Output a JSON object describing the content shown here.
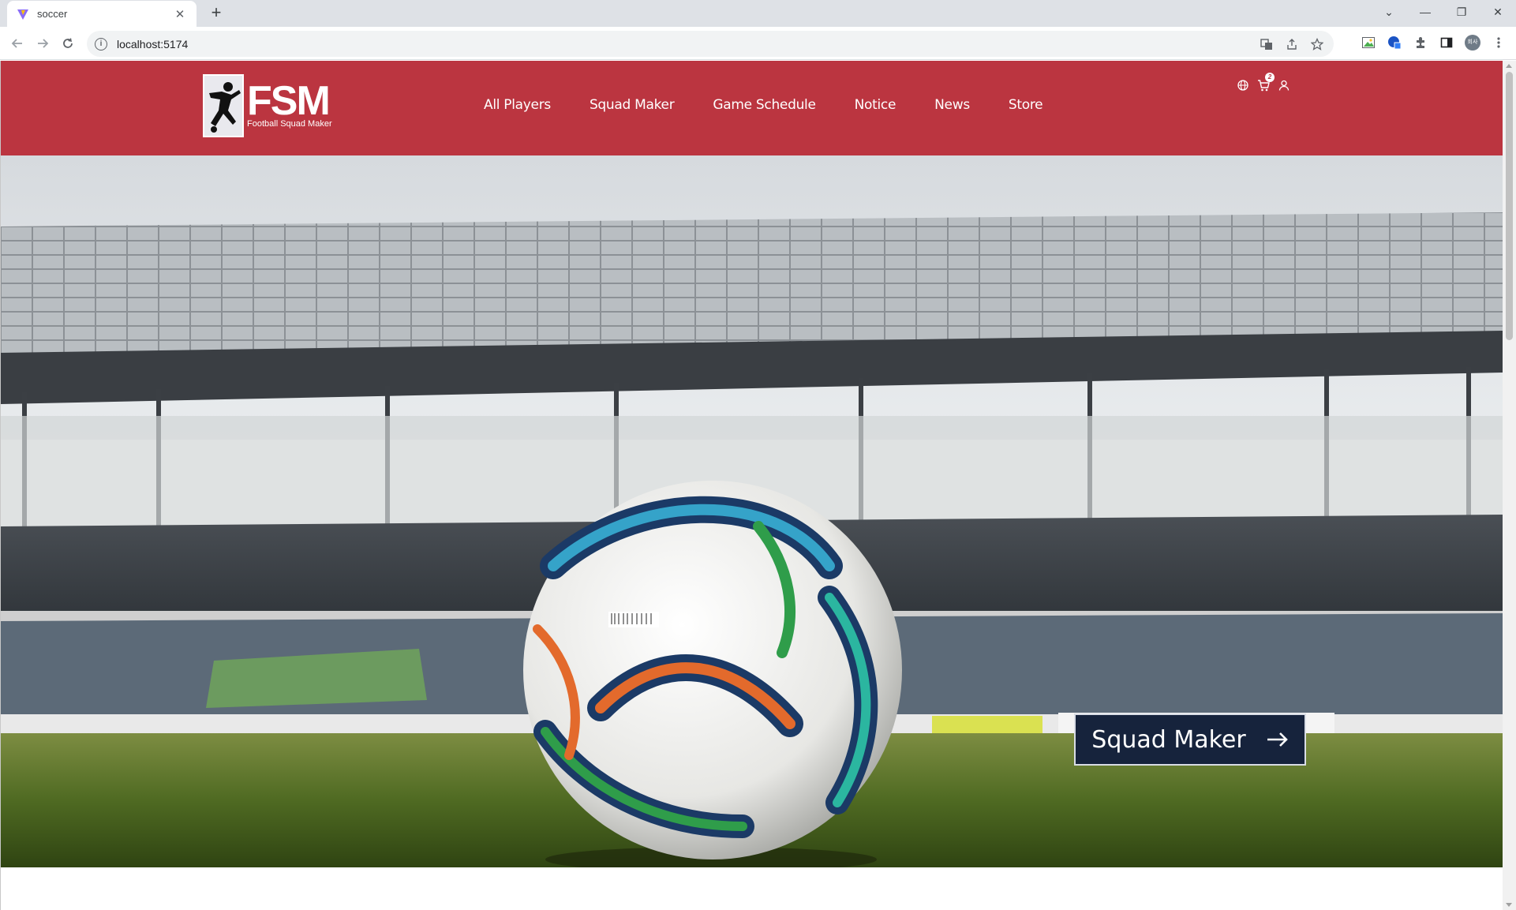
{
  "browser": {
    "tab_title": "soccer",
    "url": "localhost:5174",
    "profile_label": "회사"
  },
  "site": {
    "logo": {
      "mark": "FSM",
      "tagline": "Football Squad Maker"
    },
    "nav": [
      "All Players",
      "Squad Maker",
      "Game Schedule",
      "Notice",
      "News",
      "Store"
    ],
    "cart_count": "2",
    "header_color": "#bb3540"
  },
  "hero": {
    "cta_label": "Squad Maker",
    "cta_color": "#16233c"
  }
}
